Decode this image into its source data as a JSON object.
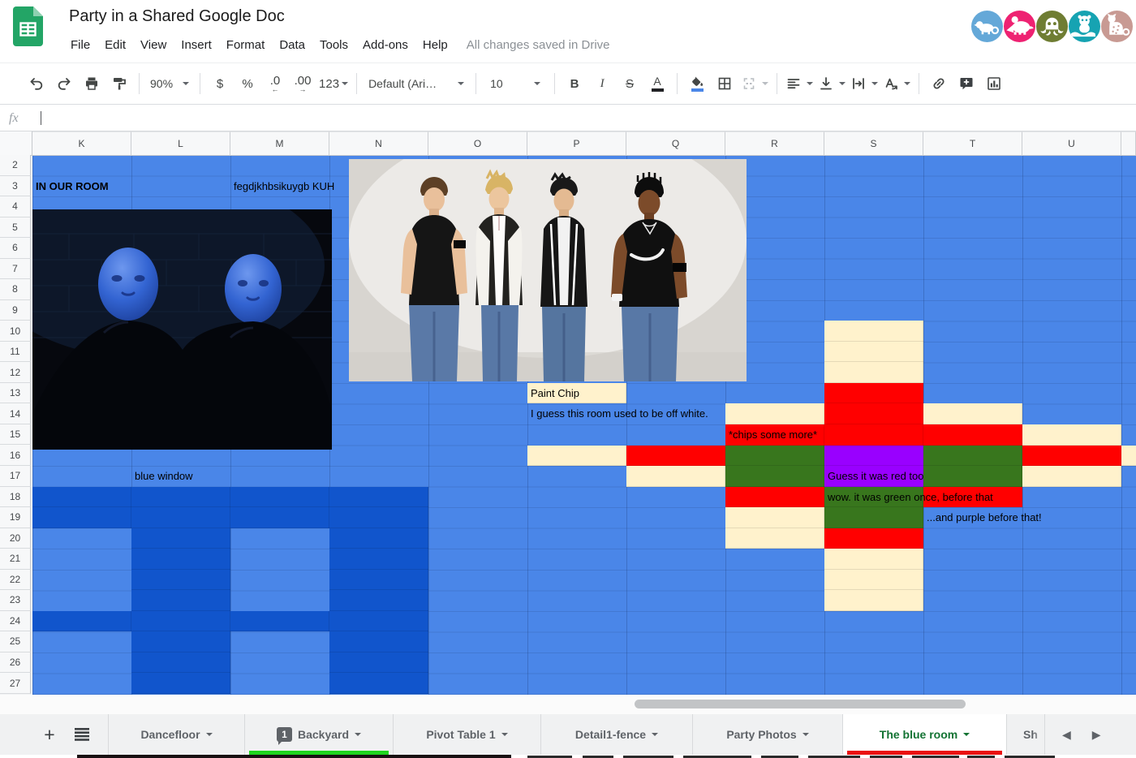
{
  "app": {
    "title": "Party in a Shared Google Doc",
    "menus": [
      "File",
      "Edit",
      "View",
      "Insert",
      "Format",
      "Data",
      "Tools",
      "Add-ons",
      "Help"
    ],
    "save_status": "All changes saved in Drive"
  },
  "avatars": [
    {
      "name": "anonymous-chameleon-avatar",
      "color": "#64a8d8"
    },
    {
      "name": "anonymous-aardvark-avatar",
      "color": "#ee2272"
    },
    {
      "name": "anonymous-octopus-avatar",
      "color": "#6f7d33"
    },
    {
      "name": "anonymous-otter-avatar",
      "color": "#16a3b2"
    },
    {
      "name": "anonymous-jaguar-avatar",
      "color": "#c89a93"
    }
  ],
  "toolbar": {
    "zoom": "90%",
    "currency": "$",
    "percent": "%",
    "decrease_decimal": ".0",
    "increase_decimal": ".00",
    "more_formats": "123",
    "font_name": "Default (Ari…",
    "font_size": "10",
    "bold": "B",
    "italic": "I",
    "strikethrough": "S",
    "text_color": "A"
  },
  "formula_bar": {
    "fx": "fx",
    "value": ""
  },
  "grid": {
    "columns": [
      "K",
      "L",
      "M",
      "N",
      "O",
      "P",
      "Q",
      "R",
      "S",
      "T",
      "U"
    ],
    "row_numbers": [
      2,
      3,
      4,
      5,
      6,
      7,
      8,
      9,
      10,
      11,
      12,
      13,
      14,
      15,
      16,
      17,
      18,
      19,
      20,
      21,
      22,
      23,
      24,
      25,
      26,
      27
    ],
    "palette": {
      "blue": "#4a86e8",
      "dark_blue": "#1155cc",
      "cream": "#fff2cc",
      "red": "#ff0000",
      "green": "#38761d",
      "purple": "#9900ff"
    },
    "cells": [
      {
        "c": "S",
        "r": 10,
        "k": "cream"
      },
      {
        "c": "S",
        "r": 11,
        "k": "cream"
      },
      {
        "c": "S",
        "r": 12,
        "k": "cream"
      },
      {
        "c": "P",
        "r": 13,
        "k": "cream"
      },
      {
        "c": "S",
        "r": 13,
        "k": "red"
      },
      {
        "c": "R",
        "r": 14,
        "k": "cream"
      },
      {
        "c": "S",
        "r": 14,
        "k": "red"
      },
      {
        "c": "T",
        "r": 14,
        "k": "cream"
      },
      {
        "c": "R",
        "r": 15,
        "k": "red"
      },
      {
        "c": "S",
        "r": 15,
        "k": "red"
      },
      {
        "c": "T",
        "r": 15,
        "k": "red"
      },
      {
        "c": "U",
        "r": 15,
        "k": "cream"
      },
      {
        "c": "P",
        "r": 16,
        "k": "cream"
      },
      {
        "c": "Q",
        "r": 16,
        "k": "red"
      },
      {
        "c": "R",
        "r": 16,
        "k": "green"
      },
      {
        "c": "S",
        "r": 16,
        "k": "purple"
      },
      {
        "c": "T",
        "r": 16,
        "k": "green"
      },
      {
        "c": "U",
        "r": 16,
        "k": "red"
      },
      {
        "c": "V",
        "r": 16,
        "k": "cream"
      },
      {
        "c": "Q",
        "r": 17,
        "k": "cream"
      },
      {
        "c": "R",
        "r": 17,
        "k": "green"
      },
      {
        "c": "S",
        "r": 17,
        "k": "purple"
      },
      {
        "c": "T",
        "r": 17,
        "k": "green"
      },
      {
        "c": "U",
        "r": 17,
        "k": "cream"
      },
      {
        "c": "R",
        "r": 18,
        "k": "red"
      },
      {
        "c": "S",
        "r": 18,
        "k": "green"
      },
      {
        "c": "T",
        "r": 18,
        "k": "red"
      },
      {
        "c": "R",
        "r": 19,
        "k": "cream"
      },
      {
        "c": "S",
        "r": 19,
        "k": "green"
      },
      {
        "c": "R",
        "r": 20,
        "k": "cream"
      },
      {
        "c": "S",
        "r": 20,
        "k": "red"
      },
      {
        "c": "S",
        "r": 21,
        "k": "cream"
      },
      {
        "c": "S",
        "r": 22,
        "k": "cream"
      },
      {
        "c": "S",
        "r": 23,
        "k": "cream"
      },
      {
        "c": "K",
        "r": 18,
        "k": "dark_blue"
      },
      {
        "c": "L",
        "r": 18,
        "k": "dark_blue"
      },
      {
        "c": "M",
        "r": 18,
        "k": "dark_blue"
      },
      {
        "c": "N",
        "r": 18,
        "k": "dark_blue"
      },
      {
        "c": "K",
        "r": 19,
        "k": "dark_blue"
      },
      {
        "c": "L",
        "r": 19,
        "k": "dark_blue"
      },
      {
        "c": "M",
        "r": 19,
        "k": "dark_blue"
      },
      {
        "c": "N",
        "r": 19,
        "k": "dark_blue"
      },
      {
        "c": "L",
        "r": 20,
        "k": "dark_blue"
      },
      {
        "c": "N",
        "r": 20,
        "k": "dark_blue"
      },
      {
        "c": "L",
        "r": 21,
        "k": "dark_blue"
      },
      {
        "c": "N",
        "r": 21,
        "k": "dark_blue"
      },
      {
        "c": "L",
        "r": 22,
        "k": "dark_blue"
      },
      {
        "c": "N",
        "r": 22,
        "k": "dark_blue"
      },
      {
        "c": "L",
        "r": 23,
        "k": "dark_blue"
      },
      {
        "c": "N",
        "r": 23,
        "k": "dark_blue"
      },
      {
        "c": "K",
        "r": 24,
        "k": "dark_blue"
      },
      {
        "c": "L",
        "r": 24,
        "k": "dark_blue"
      },
      {
        "c": "M",
        "r": 24,
        "k": "dark_blue"
      },
      {
        "c": "N",
        "r": 24,
        "k": "dark_blue"
      },
      {
        "c": "L",
        "r": 25,
        "k": "dark_blue"
      },
      {
        "c": "N",
        "r": 25,
        "k": "dark_blue"
      },
      {
        "c": "L",
        "r": 26,
        "k": "dark_blue"
      },
      {
        "c": "N",
        "r": 26,
        "k": "dark_blue"
      },
      {
        "c": "L",
        "r": 27,
        "k": "dark_blue"
      },
      {
        "c": "N",
        "r": 27,
        "k": "dark_blue"
      }
    ],
    "texts": [
      {
        "c": "K",
        "r": 3,
        "text": "IN OUR ROOM",
        "bold": true
      },
      {
        "c": "M",
        "r": 3,
        "text": "fegdjkhbsikuygb KUH",
        "bold": false
      },
      {
        "c": "P",
        "r": 13,
        "text": "Paint Chip",
        "bold": false
      },
      {
        "c": "P",
        "r": 14,
        "text": "I guess this room used to be off white.",
        "bold": false
      },
      {
        "c": "R",
        "r": 15,
        "text": "*chips some more*",
        "bold": false
      },
      {
        "c": "S",
        "r": 17,
        "text": "Guess it was red too",
        "bold": false
      },
      {
        "c": "S",
        "r": 18,
        "text": "wow. it was green once, before that",
        "bold": false
      },
      {
        "c": "T",
        "r": 19,
        "text": "...and purple before that!",
        "bold": false
      },
      {
        "c": "L",
        "r": 17,
        "text": "blue window",
        "bold": false
      }
    ]
  },
  "images": [
    {
      "name": "blue-man-group-photo",
      "alt": "Two Blue Man Group performers with blue heads and black turtlenecks on a dark stage"
    },
    {
      "name": "blue-boyband-photo",
      "alt": "Four members of the boyband Blue posing in jeans against a pale studio wall; one top reads love"
    }
  ],
  "tabs": {
    "add_label": "+",
    "items": [
      {
        "label": "Dancefloor",
        "active": false
      },
      {
        "label": "Backyard",
        "badge": "1",
        "underline": "#1fd41f",
        "active": false
      },
      {
        "label": "Pivot Table 1",
        "active": false
      },
      {
        "label": "Detail1-fence",
        "active": false
      },
      {
        "label": "Party Photos",
        "active": false
      },
      {
        "label": "The blue room",
        "active": true,
        "underline": "#ea1111"
      },
      {
        "label": "Sh",
        "partial": true,
        "active": false
      }
    ],
    "nav_prev": "◀",
    "nav_next": "▶"
  }
}
